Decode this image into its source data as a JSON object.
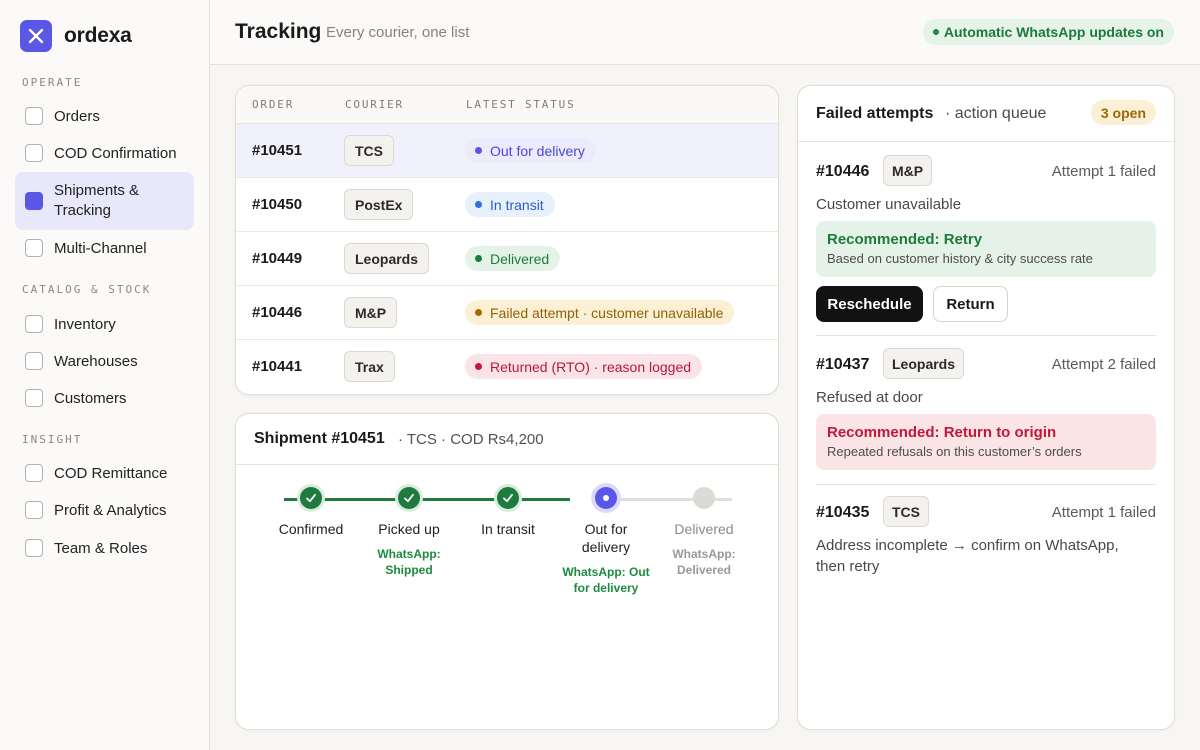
{
  "brand": {
    "name": "ordexa",
    "accent": "#5b57e6"
  },
  "sidebar": {
    "sections": [
      {
        "label": "OPERATE"
      },
      {
        "label": "CATALOG & STOCK"
      },
      {
        "label": "INSIGHT"
      }
    ],
    "items": [
      {
        "label": "Orders"
      },
      {
        "label": "COD Confirmation"
      },
      {
        "label": "Shipments &",
        "label2": "Tracking",
        "active": true
      },
      {
        "label": "Multi-Channel"
      },
      {
        "label": "Inventory"
      },
      {
        "label": "Warehouses"
      },
      {
        "label": "Customers"
      },
      {
        "label": "COD Remittance"
      },
      {
        "label": "Profit & Analytics"
      },
      {
        "label": "Team & Roles"
      }
    ]
  },
  "header": {
    "title": "Tracking",
    "subtitle": "Every courier, one list",
    "badge": "Automatic WhatsApp updates on"
  },
  "orders_table": {
    "columns": [
      "ORDER",
      "COURIER",
      "LATEST STATUS"
    ],
    "rows": [
      {
        "order": "#10451",
        "courier": "TCS",
        "status": "Out for delivery",
        "tone": "indigo",
        "selected": true
      },
      {
        "order": "#10450",
        "courier": "PostEx",
        "status": "In transit",
        "tone": "blue"
      },
      {
        "order": "#10449",
        "courier": "Leopards",
        "status": "Delivered",
        "tone": "green"
      },
      {
        "order": "#10446",
        "courier": "M&P",
        "status": "Failed attempt · customer unavailable",
        "tone": "amber"
      },
      {
        "order": "#10441",
        "courier": "Trax",
        "status": "Returned (RTO) · reason logged",
        "tone": "red"
      }
    ]
  },
  "shipment": {
    "title": "Shipment #10451",
    "meta": "· TCS · COD Rs4,200",
    "steps": [
      {
        "label": "Confirmed",
        "label2": "",
        "note": "",
        "note2": "",
        "state": "done"
      },
      {
        "label": "Picked up",
        "label2": "",
        "note": "WhatsApp:",
        "note2": "Shipped",
        "state": "done"
      },
      {
        "label": "In transit",
        "label2": "",
        "note": "",
        "note2": "",
        "state": "done"
      },
      {
        "label": "Out for",
        "label2": "delivery",
        "note": "WhatsApp: Out",
        "note2": "for delivery",
        "state": "current"
      },
      {
        "label": "Delivered",
        "label2": "",
        "note": "WhatsApp:",
        "note2": "Delivered",
        "state": "pending"
      }
    ]
  },
  "failed_attempts": {
    "title": "Failed attempts",
    "subtitle": "· action queue",
    "open_badge": "3 open",
    "items": [
      {
        "order": "#10446",
        "courier": "M&P",
        "attempt": "Attempt 1 failed",
        "reason": "Customer unavailable",
        "reco_title": "Recommended: Retry",
        "reco_detail": "Based on customer history & city success rate",
        "buttons": [
          "Reschedule",
          "Return"
        ]
      },
      {
        "order": "#10437",
        "courier": "Leopards",
        "attempt": "Attempt 2 failed",
        "reason": "Refused at door",
        "reco_title": "Recommended: Return to origin",
        "reco_detail": "Repeated refusals on this customer’s orders"
      },
      {
        "order": "#10435",
        "courier": "TCS",
        "attempt": "Attempt 1 failed",
        "reason": "Address incomplete → confirm on WhatsApp,",
        "reason2": "then retry"
      }
    ]
  },
  "colors": {
    "status_indigo": "#5b57e6",
    "status_blue": "#2f6fe0",
    "status_green": "#1f7a3d",
    "status_amber": "#a36a05",
    "status_red": "#c4183a"
  }
}
